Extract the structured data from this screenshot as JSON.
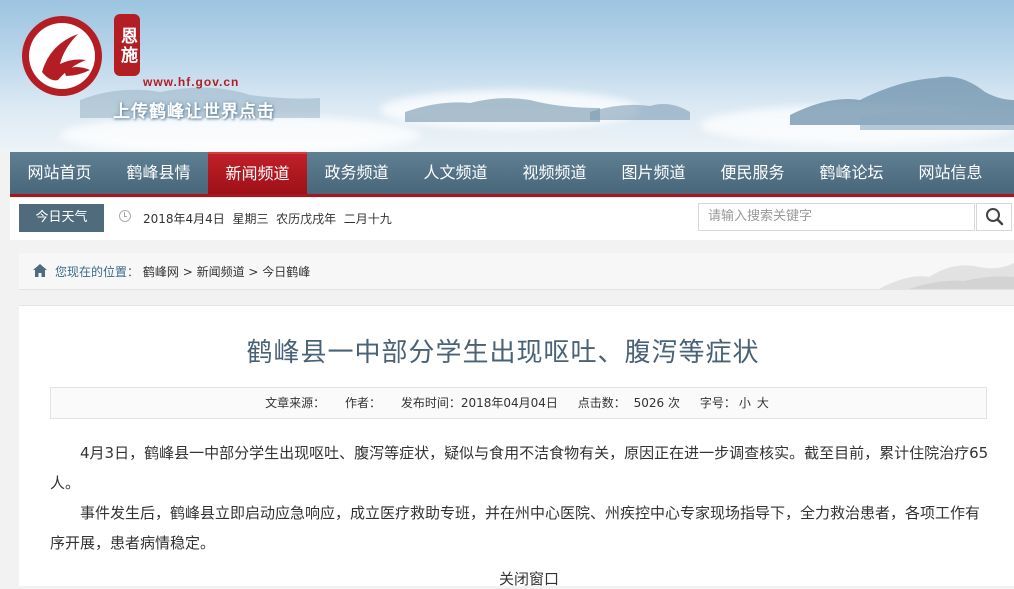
{
  "header": {
    "logo_badge": "恩施",
    "url": "www.hf.gov.cn",
    "slogan": "上传鹤峰让世界点击"
  },
  "nav": {
    "items": [
      {
        "label": "网站首页",
        "active": false
      },
      {
        "label": "鹤峰县情",
        "active": false
      },
      {
        "label": "新闻频道",
        "active": true
      },
      {
        "label": "政务频道",
        "active": false
      },
      {
        "label": "人文频道",
        "active": false
      },
      {
        "label": "视频频道",
        "active": false
      },
      {
        "label": "图片频道",
        "active": false
      },
      {
        "label": "便民服务",
        "active": false
      },
      {
        "label": "鹤峰论坛",
        "active": false
      },
      {
        "label": "网站信息",
        "active": false
      }
    ]
  },
  "infobar": {
    "weather_label": "今日天气",
    "date": "2018年4月4日  星期三  农历戊戌年  二月十九",
    "search_placeholder": "请输入搜索关键字"
  },
  "breadcrumb": {
    "label": "您现在的位置：",
    "items": [
      "鹤峰网",
      "新闻频道",
      "今日鹤峰"
    ]
  },
  "article": {
    "title": "鹤峰县一中部分学生出现呕吐、腹泻等症状",
    "meta": {
      "source": "文章来源：",
      "author": "作者：",
      "published": "发布时间：2018年04月04日",
      "clicks_label": "点击数：",
      "clicks_value": "5026",
      "clicks_unit": "次",
      "font_label": "字号：",
      "font_small": "小",
      "font_large": "大"
    },
    "paragraphs": [
      "4月3日，鹤峰县一中部分学生出现呕吐、腹泻等症状，疑似与食用不洁食物有关，原因正在进一步调查核实。截至目前，累计住院治疗65人。",
      "事件发生后，鹤峰县立即启动应急响应，成立医疗救助专班，并在州中心医院、州疾控中心专家现场指导下，全力救治患者，各项工作有序开展，患者病情稳定。"
    ],
    "cut_text": "关闭窗口"
  },
  "colors": {
    "brand_red": "#b41d24",
    "nav_bg": "#547487",
    "nav_active": "#b0161e",
    "title_color": "#4a6275"
  }
}
